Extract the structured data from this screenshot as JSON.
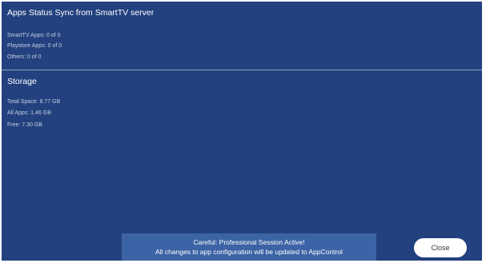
{
  "sync_section": {
    "title": "Apps Status Sync from SmartTV server",
    "lines": [
      "SmartTV Apps: 0 of 0",
      "Playstore Apps: 0 of 0",
      "Others: 0 of 0"
    ]
  },
  "storage_section": {
    "title": "Storage",
    "lines": [
      "Total Space: 8.77 GB",
      "All Apps: 1.46 GB",
      "Free: 7.30 GB"
    ]
  },
  "toast": {
    "line1": "Careful: Professional Session Active!",
    "line2": "All changes to app configuration will be updated to AppControl"
  },
  "close_button": {
    "label": "Close"
  },
  "colors": {
    "background": "#23417e",
    "toast": "#3c63a5",
    "divider": "#8fa2c9"
  }
}
